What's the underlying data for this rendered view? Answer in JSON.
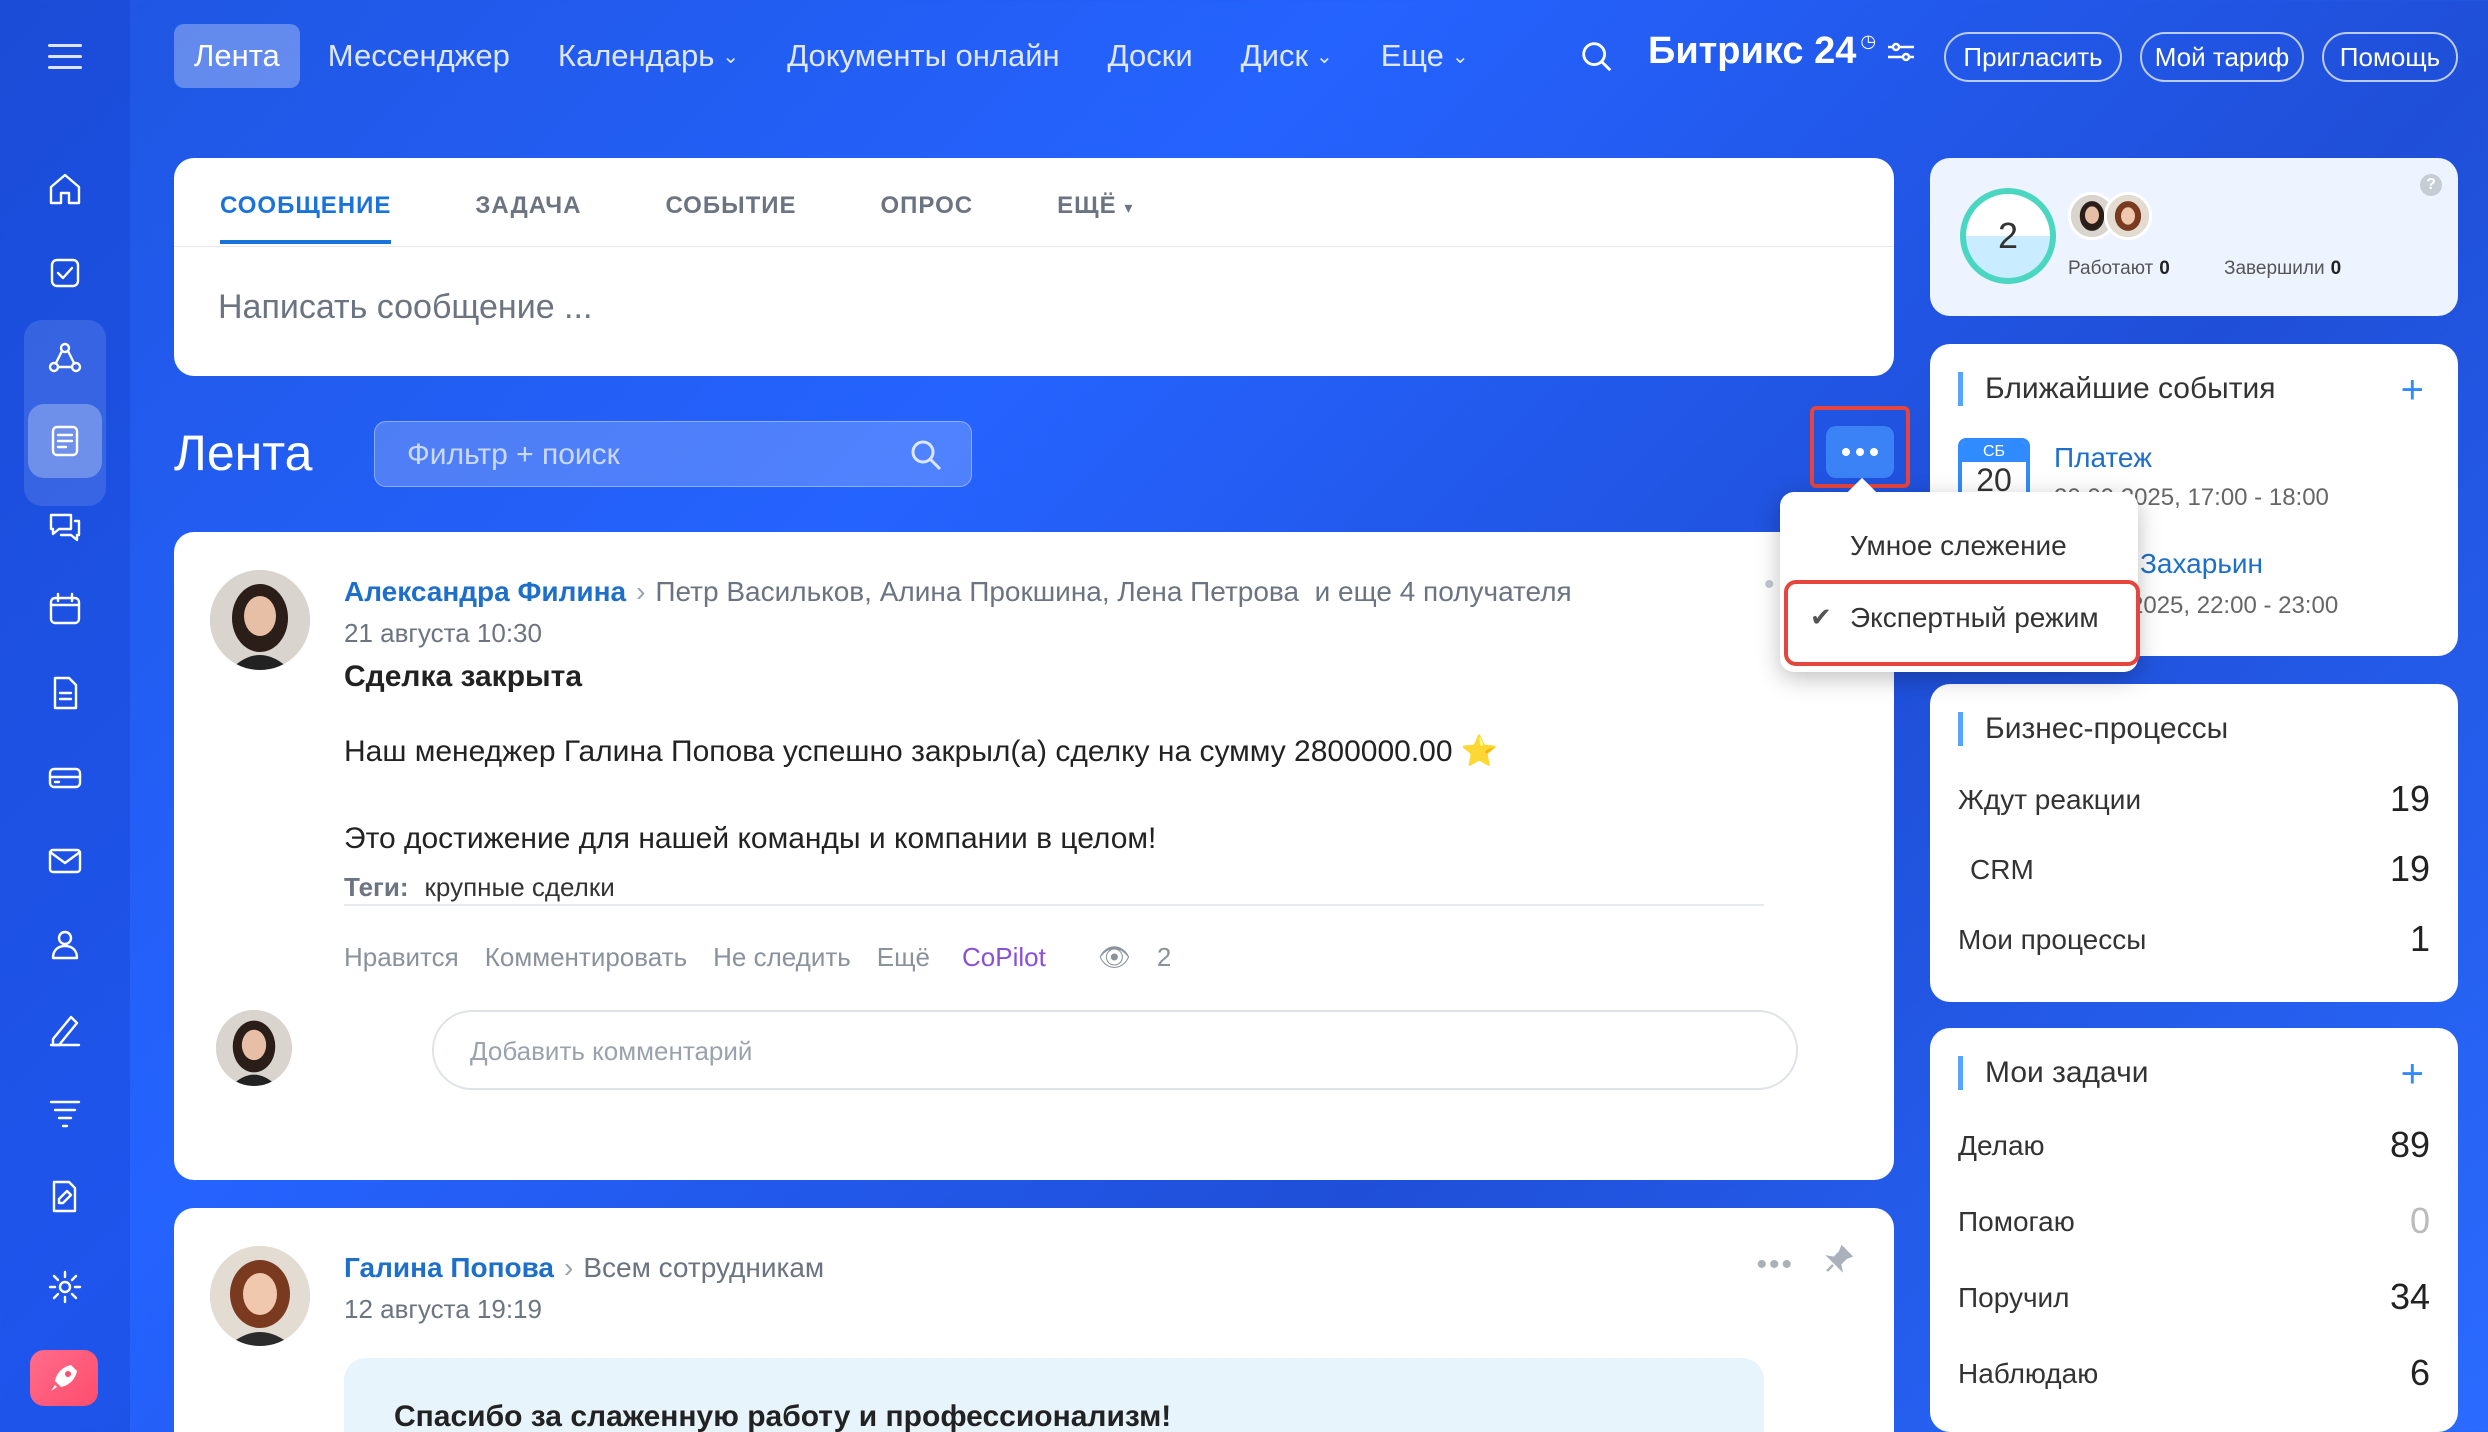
{
  "nav": {
    "items": [
      {
        "label": "Лента",
        "active": true,
        "dropdown": false
      },
      {
        "label": "Мессенджер",
        "active": false,
        "dropdown": false
      },
      {
        "label": "Календарь",
        "active": false,
        "dropdown": true
      },
      {
        "label": "Документы онлайн",
        "active": false,
        "dropdown": false
      },
      {
        "label": "Доски",
        "active": false,
        "dropdown": false
      },
      {
        "label": "Диск",
        "active": false,
        "dropdown": true
      },
      {
        "label": "Еще",
        "active": false,
        "dropdown": true
      }
    ],
    "brand": "Битрикс 24",
    "invite": "Пригласить",
    "tariff": "Мой тариф",
    "help": "Помощь"
  },
  "composer": {
    "tabs": [
      "СООБЩЕНИЕ",
      "ЗАДАЧА",
      "СОБЫТИЕ",
      "ОПРОС",
      "ЕЩЁ"
    ],
    "placeholder": "Написать сообщение ..."
  },
  "feed": {
    "title": "Лента",
    "filter_placeholder": "Фильтр + поиск"
  },
  "menu": {
    "items": [
      {
        "label": "Умное слежение",
        "checked": false
      },
      {
        "label": "Экспертный режим",
        "checked": true
      }
    ]
  },
  "post1": {
    "author": "Александра Филина",
    "recipients": "Петр Васильков, Алина Прокшина, Лена Петрова",
    "more_recipients": "и еще 4 получателя",
    "date": "21 августа 10:30",
    "title": "Сделка закрыта",
    "text1": "Наш менеджер Галина Попова успешно закрыл(а) сделку на сумму 2800000.00 ⭐",
    "text2": "Это достижение для нашей команды и компании в целом!",
    "tags_label": "Теги:",
    "tags": "крупные сделки",
    "actions": {
      "like": "Нравится",
      "comment": "Комментировать",
      "unfollow": "Не следить",
      "more": "Ещё",
      "copilot": "CoPilot",
      "views": "2"
    },
    "comment_placeholder": "Добавить комментарий"
  },
  "post2": {
    "author": "Галина Попова",
    "recipients": "Всем сотрудникам",
    "date": "12 августа 19:19",
    "block_text": "Спасибо за слаженную работу и профессионализм!"
  },
  "pulse": {
    "count": "2",
    "working_label": "Работают",
    "working": "0",
    "done_label": "Завершили",
    "done": "0"
  },
  "events": {
    "title": "Ближайшие события",
    "cal_day_name": "СБ",
    "cal_day": "20",
    "items": [
      {
        "name": "Платеж",
        "time": "20.09.2025, 17:00 - 18:00"
      },
      {
        "name": "Захарьин",
        "time": "2025, 22:00 - 23:00"
      }
    ]
  },
  "bp": {
    "title": "Бизнес-процессы",
    "rows": [
      {
        "label": "Ждут реакции",
        "value": "19"
      },
      {
        "label": "CRM",
        "value": "19"
      },
      {
        "label": "Мои процессы",
        "value": "1"
      }
    ]
  },
  "tasks": {
    "title": "Мои задачи",
    "rows": [
      {
        "label": "Делаю",
        "value": "89"
      },
      {
        "label": "Помогаю",
        "value": "0"
      },
      {
        "label": "Поручил",
        "value": "34"
      },
      {
        "label": "Наблюдаю",
        "value": "6"
      }
    ]
  }
}
